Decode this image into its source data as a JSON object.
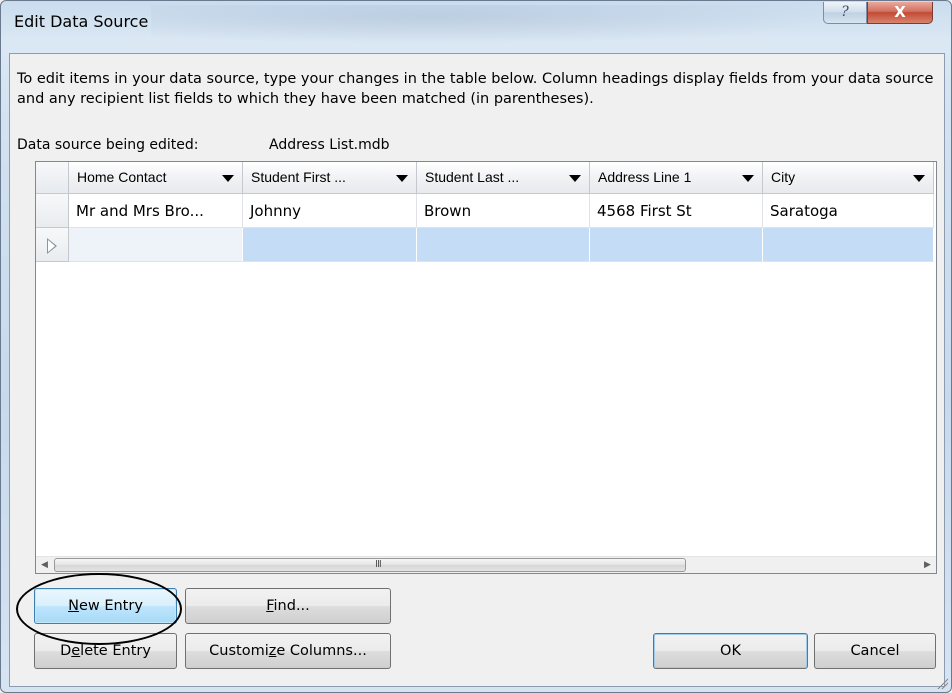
{
  "window": {
    "title": "Edit Data Source",
    "help_icon": "?",
    "close_icon": "X"
  },
  "description": "To edit items in your data source, type your changes in the table below. Column headings display fields from your data source and any recipient list fields to which they have been matched (in parentheses).",
  "data_source": {
    "label": "Data source being edited:",
    "value": "Address List.mdb"
  },
  "grid": {
    "columns": [
      "Home Contact",
      "Student First ...",
      "Student Last ...",
      "Address Line 1",
      "City"
    ],
    "rows": [
      [
        "Mr and Mrs Bro...",
        "Johnny",
        "Brown",
        "4568 First St",
        "Saratoga"
      ]
    ],
    "scroll_left": "◀",
    "scroll_right": "▶",
    "scroll_grip": "III"
  },
  "buttons": {
    "new_entry": {
      "pre": "",
      "u": "N",
      "post": "ew Entry"
    },
    "find": {
      "pre": "",
      "u": "F",
      "post": "ind..."
    },
    "delete_entry": {
      "pre": "D",
      "u": "e",
      "post": "lete Entry"
    },
    "customize_columns": {
      "pre": "Customi",
      "u": "z",
      "post": "e Columns..."
    },
    "ok": "OK",
    "cancel": "Cancel"
  },
  "colors": {
    "new_row_highlight": "#c4dcf6",
    "close_button": "#c24a36",
    "annotation_circle": "#000000"
  }
}
